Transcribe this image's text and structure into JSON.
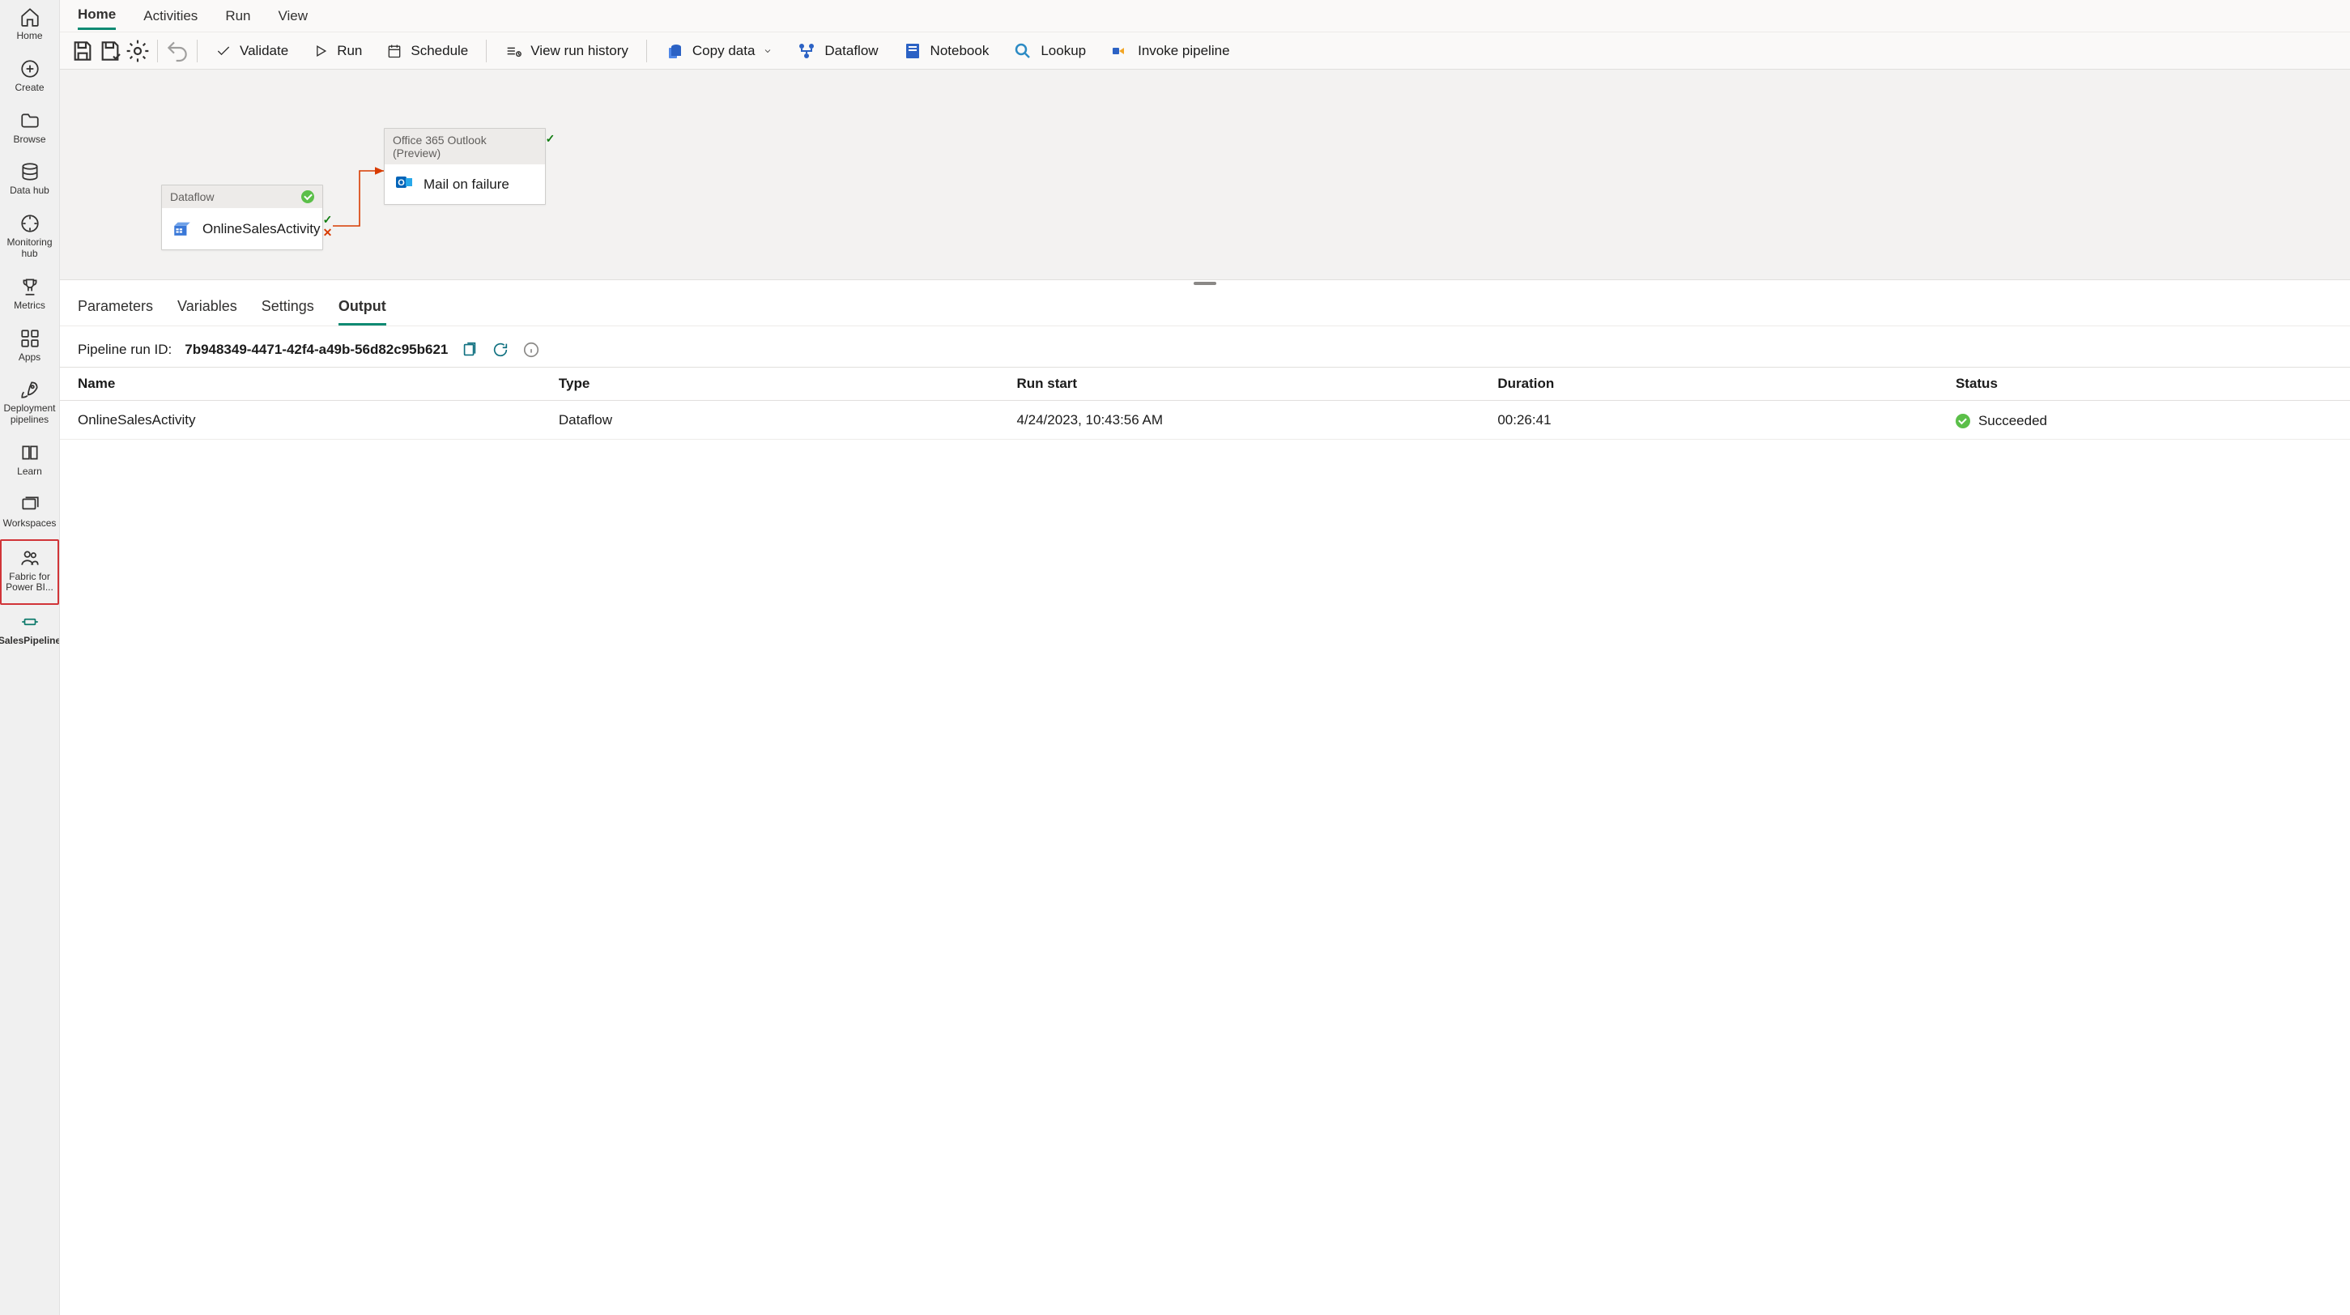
{
  "sidebar": {
    "items": [
      {
        "label": "Home"
      },
      {
        "label": "Create"
      },
      {
        "label": "Browse"
      },
      {
        "label": "Data hub"
      },
      {
        "label": "Monitoring hub"
      },
      {
        "label": "Metrics"
      },
      {
        "label": "Apps"
      },
      {
        "label": "Deployment pipelines"
      },
      {
        "label": "Learn"
      },
      {
        "label": "Workspaces"
      },
      {
        "label": "Fabric for Power BI..."
      },
      {
        "label": "SalesPipeline"
      }
    ]
  },
  "tabs": [
    "Home",
    "Activities",
    "Run",
    "View"
  ],
  "active_tab": "Home",
  "ribbon": {
    "validate": "Validate",
    "run": "Run",
    "schedule": "Schedule",
    "viewrunhistory": "View run history",
    "copydata": "Copy data",
    "dataflow": "Dataflow",
    "notebook": "Notebook",
    "lookup": "Lookup",
    "invokepipeline": "Invoke pipeline"
  },
  "canvas": {
    "dataflow": {
      "header": "Dataflow",
      "name": "OnlineSalesActivity"
    },
    "outlook": {
      "header": "Office 365 Outlook (Preview)",
      "name": "Mail on failure"
    }
  },
  "panel": {
    "tabs": [
      "Parameters",
      "Variables",
      "Settings",
      "Output"
    ],
    "active": "Output",
    "runid_label": "Pipeline run ID:",
    "runid": "7b948349-4471-42f4-a49b-56d82c95b621",
    "columns": [
      "Name",
      "Type",
      "Run start",
      "Duration",
      "Status"
    ],
    "rows": [
      {
        "name": "OnlineSalesActivity",
        "type": "Dataflow",
        "start": "4/24/2023, 10:43:56 AM",
        "duration": "00:26:41",
        "status": "Succeeded"
      }
    ]
  }
}
